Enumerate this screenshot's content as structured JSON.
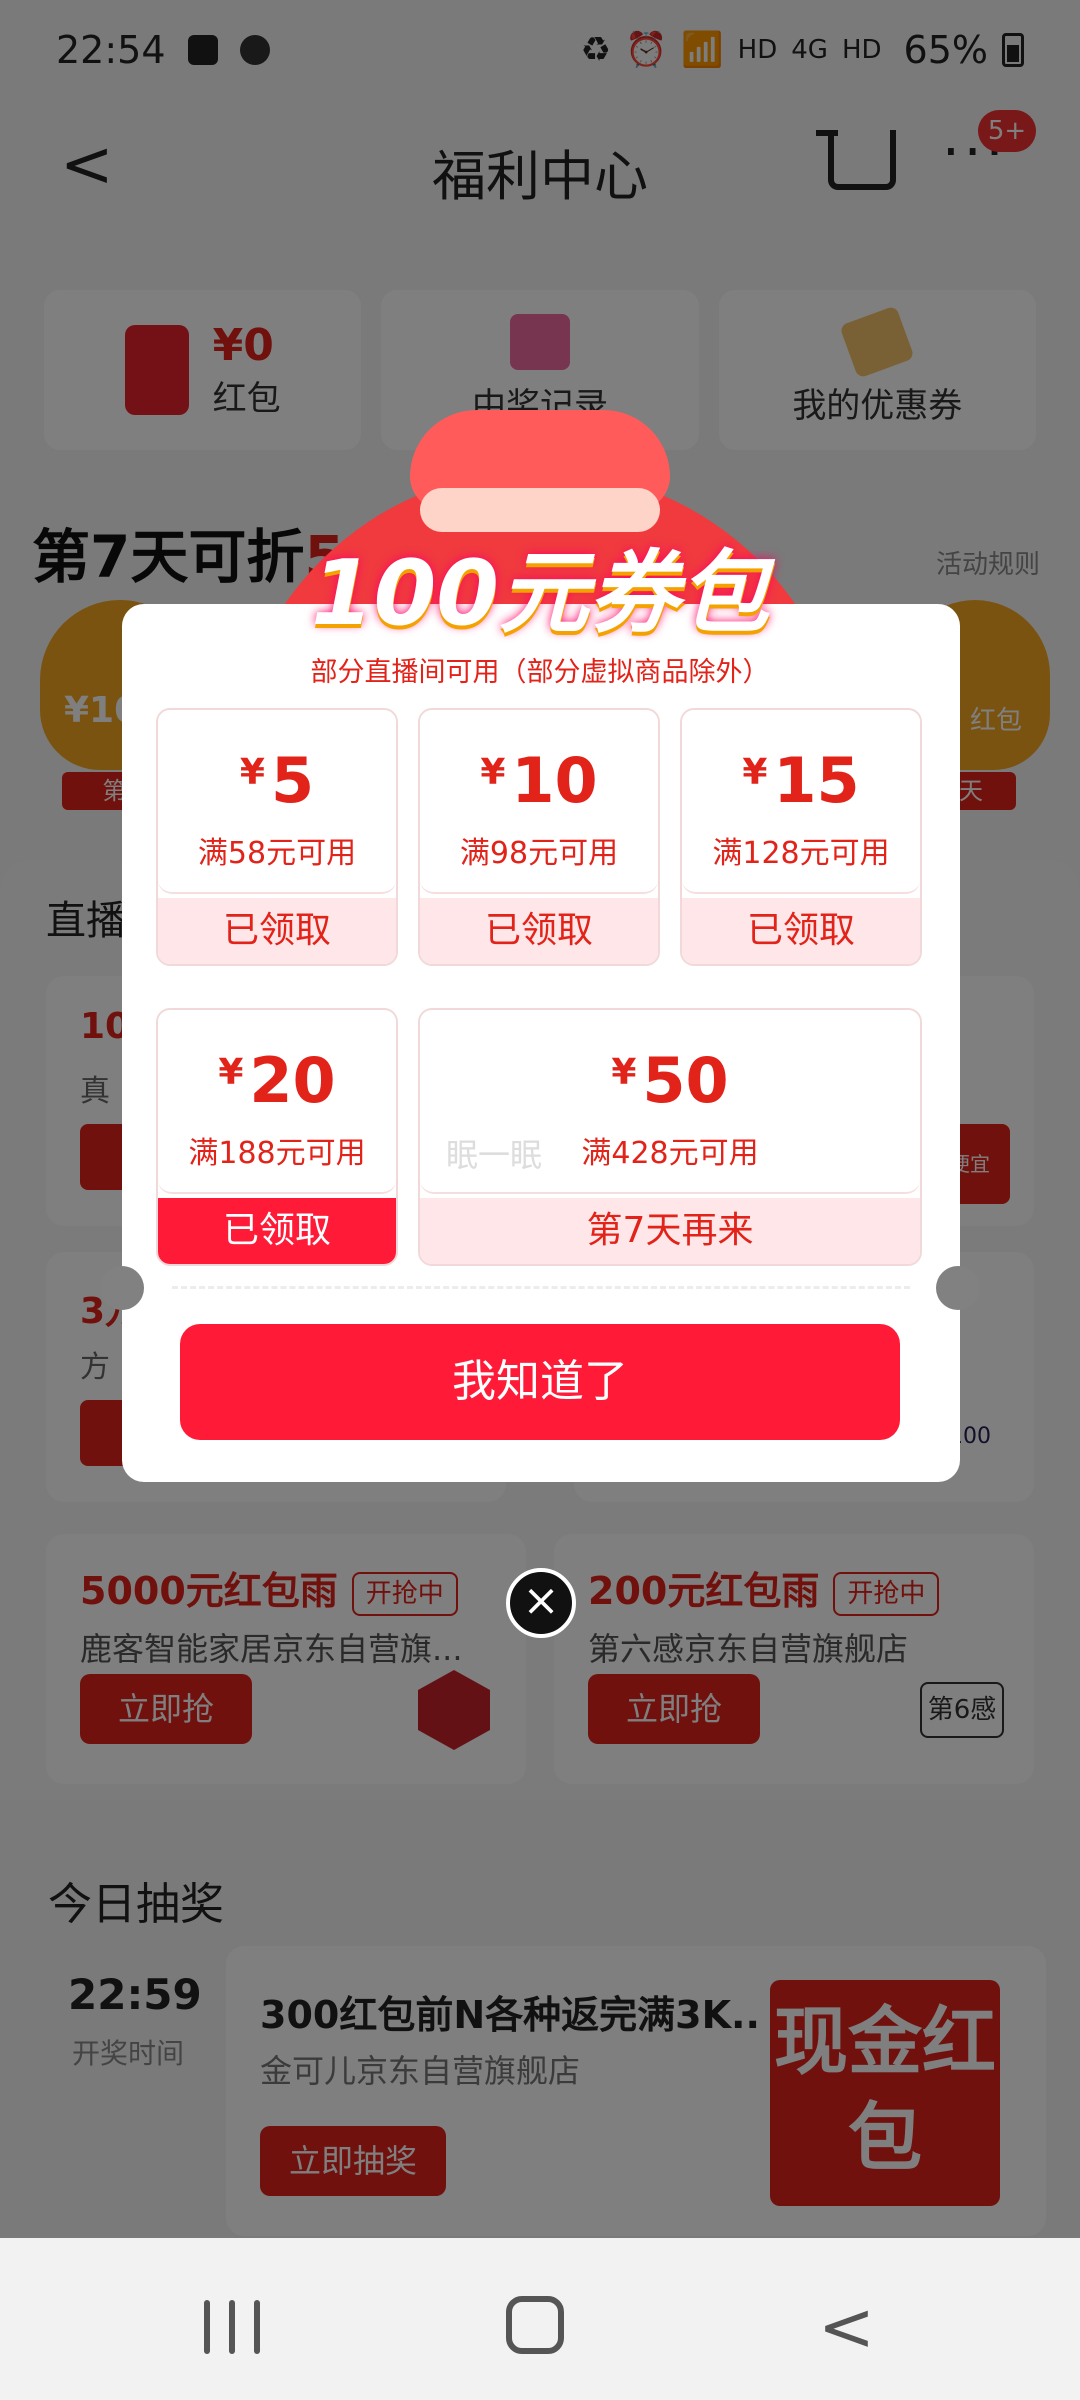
{
  "status_bar": {
    "time": "22:54",
    "network": "HD",
    "network2": "HD",
    "signal_label": "4G",
    "battery": "65%"
  },
  "nav": {
    "title": "福利中心",
    "badge": "5+"
  },
  "top_cards": {
    "redpack_amount": "¥0",
    "redpack_label": "红包",
    "prize_label": "中奖记录",
    "coupon_label": "我的优惠券"
  },
  "promo": {
    "title_prefix": "第7天可折",
    "title_suffix": "5",
    "rules": "活动规则",
    "bag_left_amount": "¥10",
    "bag_left_label": "第1",
    "bag_right_amount": "红包",
    "bag_right_label": "天"
  },
  "stream_section": {
    "title": "直播",
    "cards": [
      {
        "amount": "10",
        "shop": "真"
      },
      {
        "amount": "",
        "shop": "",
        "side": "便宜"
      },
      {
        "amount": "3万",
        "shop": "方"
      },
      {
        "amount": "",
        "shop": "",
        "logo": "100"
      }
    ]
  },
  "rain_cards": [
    {
      "title": "5000元红包雨",
      "tag": "开抢中",
      "shop": "鹿客智能家居京东自营旗...",
      "button": "立即抢"
    },
    {
      "title": "200元红包雨",
      "tag": "开抢中",
      "shop": "第六感京东自营旗舰店",
      "button": "立即抢",
      "logo": "第6感"
    }
  ],
  "lottery": {
    "section_title": "今日抽奖",
    "time": "22:59",
    "time_label": "开奖时间",
    "title": "300红包前N各种返完满3K...",
    "shop": "金可儿京东自营旗舰店",
    "button": "立即抽奖",
    "image_text": "现金红包"
  },
  "modal": {
    "title": "100元券包",
    "subtitle": "部分直播间可用（部分虚拟商品除外）",
    "coupons": [
      {
        "currency": "¥",
        "amount": "5",
        "condition": "满58元可用",
        "status": "已领取",
        "active": false
      },
      {
        "currency": "¥",
        "amount": "10",
        "condition": "满98元可用",
        "status": "已领取",
        "active": false
      },
      {
        "currency": "¥",
        "amount": "15",
        "condition": "满128元可用",
        "status": "已领取",
        "active": false
      },
      {
        "currency": "¥",
        "amount": "20",
        "condition": "满188元可用",
        "status": "已领取",
        "active": true
      },
      {
        "currency": "¥",
        "amount": "50",
        "condition": "满428元可用",
        "status": "第7天再来",
        "active": false,
        "ghost_text": "眠一眠"
      }
    ],
    "confirm_button": "我知道了",
    "close_icon": "×"
  },
  "colors": {
    "accent": "#ff1b38",
    "brand_red": "#e2231a",
    "coupon_status_bg": "#ffe6e8"
  }
}
